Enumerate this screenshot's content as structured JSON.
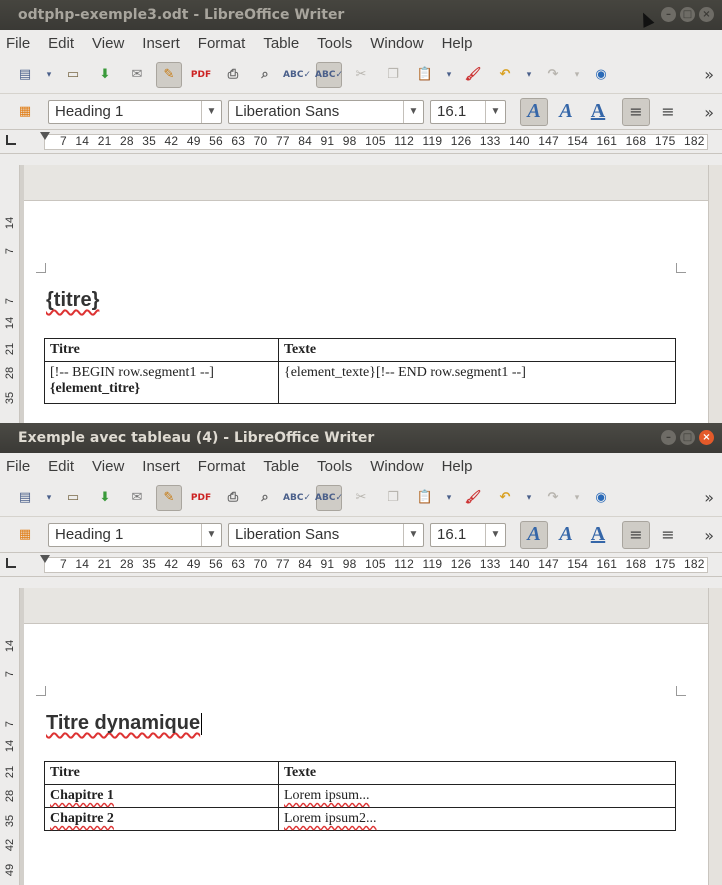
{
  "menus": [
    "File",
    "Edit",
    "View",
    "Insert",
    "Format",
    "Table",
    "Tools",
    "Window",
    "Help"
  ],
  "toolbar_icons": [
    "new-document-icon",
    "open-folder-icon",
    "save-icon",
    "email-icon",
    "edit-mode-icon",
    "export-pdf-icon",
    "print-icon",
    "print-preview-icon",
    "spellcheck-icon",
    "auto-spellcheck-icon",
    "cut-icon",
    "copy-icon",
    "paste-icon",
    "clone-formatting-icon",
    "undo-icon",
    "redo-icon",
    "navigator-icon"
  ],
  "format": {
    "style": "Heading 1",
    "font": "Liberation Sans",
    "size": "16.1"
  },
  "ruler": {
    "h_ticks": "7 14 21 28 35 42 49 56 63 70 77 84 91 98 105 112 119 126 133 140 147 154 161 168 175 182",
    "v_ticks_top": [
      "14",
      "7"
    ],
    "v_ticks_main": [
      "7",
      "14",
      "21",
      "28",
      "35",
      "42",
      "49"
    ]
  },
  "windows": [
    {
      "title": "odtphp-exemple3.odt - LibreOffice Writer",
      "doc_heading": "{titre}",
      "table": {
        "headers": [
          "Titre",
          "Texte"
        ],
        "rows": [
          {
            "c1_line1": "[!-- BEGIN row.segment1 --]",
            "c1_line2": "{element_titre}",
            "c2": "{element_texte}[!-- END row.segment1 --]"
          }
        ]
      }
    },
    {
      "title": "Exemple avec tableau (4) - LibreOffice Writer",
      "doc_heading": "Titre dynamique",
      "table": {
        "headers": [
          "Titre",
          "Texte"
        ],
        "rows": [
          {
            "c1": "Chapitre 1",
            "c2": "Lorem ipsum..."
          },
          {
            "c1": "Chapitre 2",
            "c2": "Lorem ipsum2..."
          }
        ]
      }
    }
  ]
}
